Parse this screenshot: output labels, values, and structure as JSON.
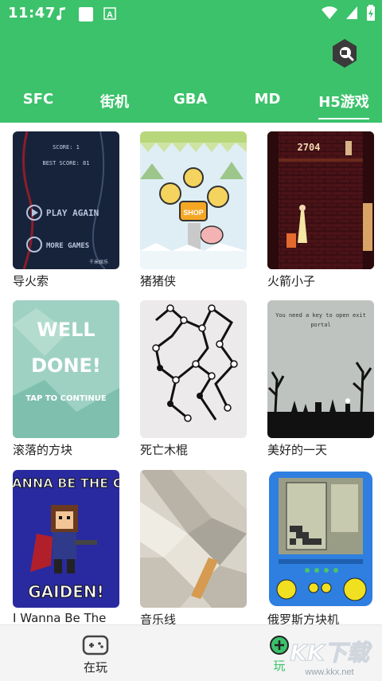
{
  "status_bar": {
    "time": "11:47",
    "icons": [
      "music-note-icon",
      "square-icon",
      "a-badge-icon",
      "wifi-icon",
      "signal-icon",
      "battery-icon"
    ]
  },
  "header": {
    "background": "#3cc26b",
    "action_icon": "hexagon-search-icon"
  },
  "tabs": [
    {
      "label": "SFC"
    },
    {
      "label": "街机"
    },
    {
      "label": "GBA"
    },
    {
      "label": "MD"
    },
    {
      "label": "H5游戏",
      "active": true
    }
  ],
  "games": [
    {
      "title": "导火索",
      "thumb_text": [
        "SCORE: 1",
        "BEST SCORE: 81",
        "PLAY AGAIN",
        "MORE GAMES",
        "千米娱乐"
      ]
    },
    {
      "title": "猪猪侠",
      "thumb_text": [
        "SHOP"
      ]
    },
    {
      "title": "火箭小子",
      "thumb_text": [
        "2704"
      ]
    },
    {
      "title": "滚落的方块",
      "thumb_text": [
        "WELL",
        "DONE!",
        "TAP TO CONTINUE"
      ]
    },
    {
      "title": "死亡木棍",
      "thumb_text": []
    },
    {
      "title": "美好的一天",
      "thumb_text": [
        "You need a key to open exit",
        "portal"
      ]
    },
    {
      "title": "I Wanna Be The",
      "thumb_text": [
        "WANNA BE THE GU",
        "GAIDEN!"
      ]
    },
    {
      "title": "音乐线",
      "thumb_text": []
    },
    {
      "title": "俄罗斯方块机",
      "thumb_text": []
    }
  ],
  "bottom_nav": [
    {
      "label": "在玩",
      "icon": "gamepad-icon"
    },
    {
      "label": "玩",
      "icon": "add-circle-icon"
    }
  ],
  "watermark": {
    "text": "KK下载",
    "url": "www.kkx.net"
  }
}
